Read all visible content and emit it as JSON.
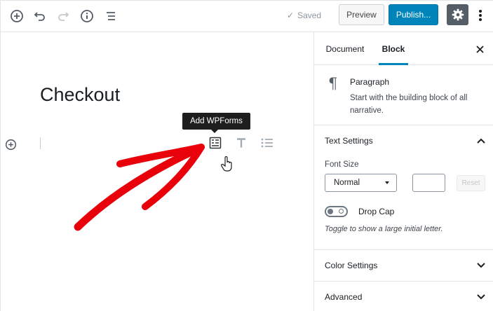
{
  "toolbar": {
    "add_block_icon": "plus-circle-icon",
    "undo_icon": "undo-icon",
    "redo_icon": "redo-icon",
    "info_icon": "info-icon",
    "outline_icon": "list-outline-icon",
    "saved_label": "Saved",
    "preview_label": "Preview",
    "publish_label": "Publish...",
    "settings_icon": "gear-icon",
    "more_icon": "vertical-ellipsis-icon"
  },
  "editor": {
    "title": "Checkout",
    "tooltip": "Add WPForms",
    "suggested_blocks": [
      "wpforms-icon",
      "heading-icon",
      "list-icon"
    ]
  },
  "sidebar": {
    "tabs": [
      {
        "label": "Document",
        "active": false
      },
      {
        "label": "Block",
        "active": true
      }
    ],
    "block": {
      "name": "Paragraph",
      "description": "Start with the building block of all narrative."
    },
    "text_settings": {
      "title": "Text Settings",
      "font_size_label": "Font Size",
      "font_size_value": "Normal",
      "custom_size_value": "",
      "reset_label": "Reset",
      "drop_cap_label": "Drop Cap",
      "drop_cap_help": "Toggle to show a large initial letter.",
      "drop_cap_enabled": false
    },
    "color_settings": {
      "title": "Color Settings"
    },
    "advanced": {
      "title": "Advanced"
    }
  },
  "colors": {
    "primary": "#0085ba",
    "annotation_arrow": "#e8000b",
    "settings_button": "#555d66"
  }
}
